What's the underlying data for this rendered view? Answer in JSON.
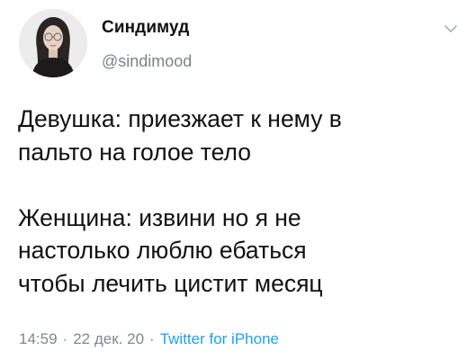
{
  "author": {
    "display_name": "Синдимуд",
    "handle": "@sindimood",
    "avatar_icon": "user-avatar"
  },
  "menu_icon": "chevron-down-icon",
  "tweet": {
    "lines_block1": [
      "Девушка: приезжает к нему в",
      "пальто на голое тело"
    ],
    "lines_block2": [
      "Женщина: извини но я не",
      "настолько люблю ебаться",
      "чтобы лечить цистит месяц"
    ]
  },
  "meta": {
    "time": "14:59",
    "date": "22 дек. 20",
    "separator": "·",
    "source": "Twitter for iPhone"
  },
  "colors": {
    "text": "#111111",
    "secondary": "#7f888f",
    "link": "#1da1f2"
  }
}
